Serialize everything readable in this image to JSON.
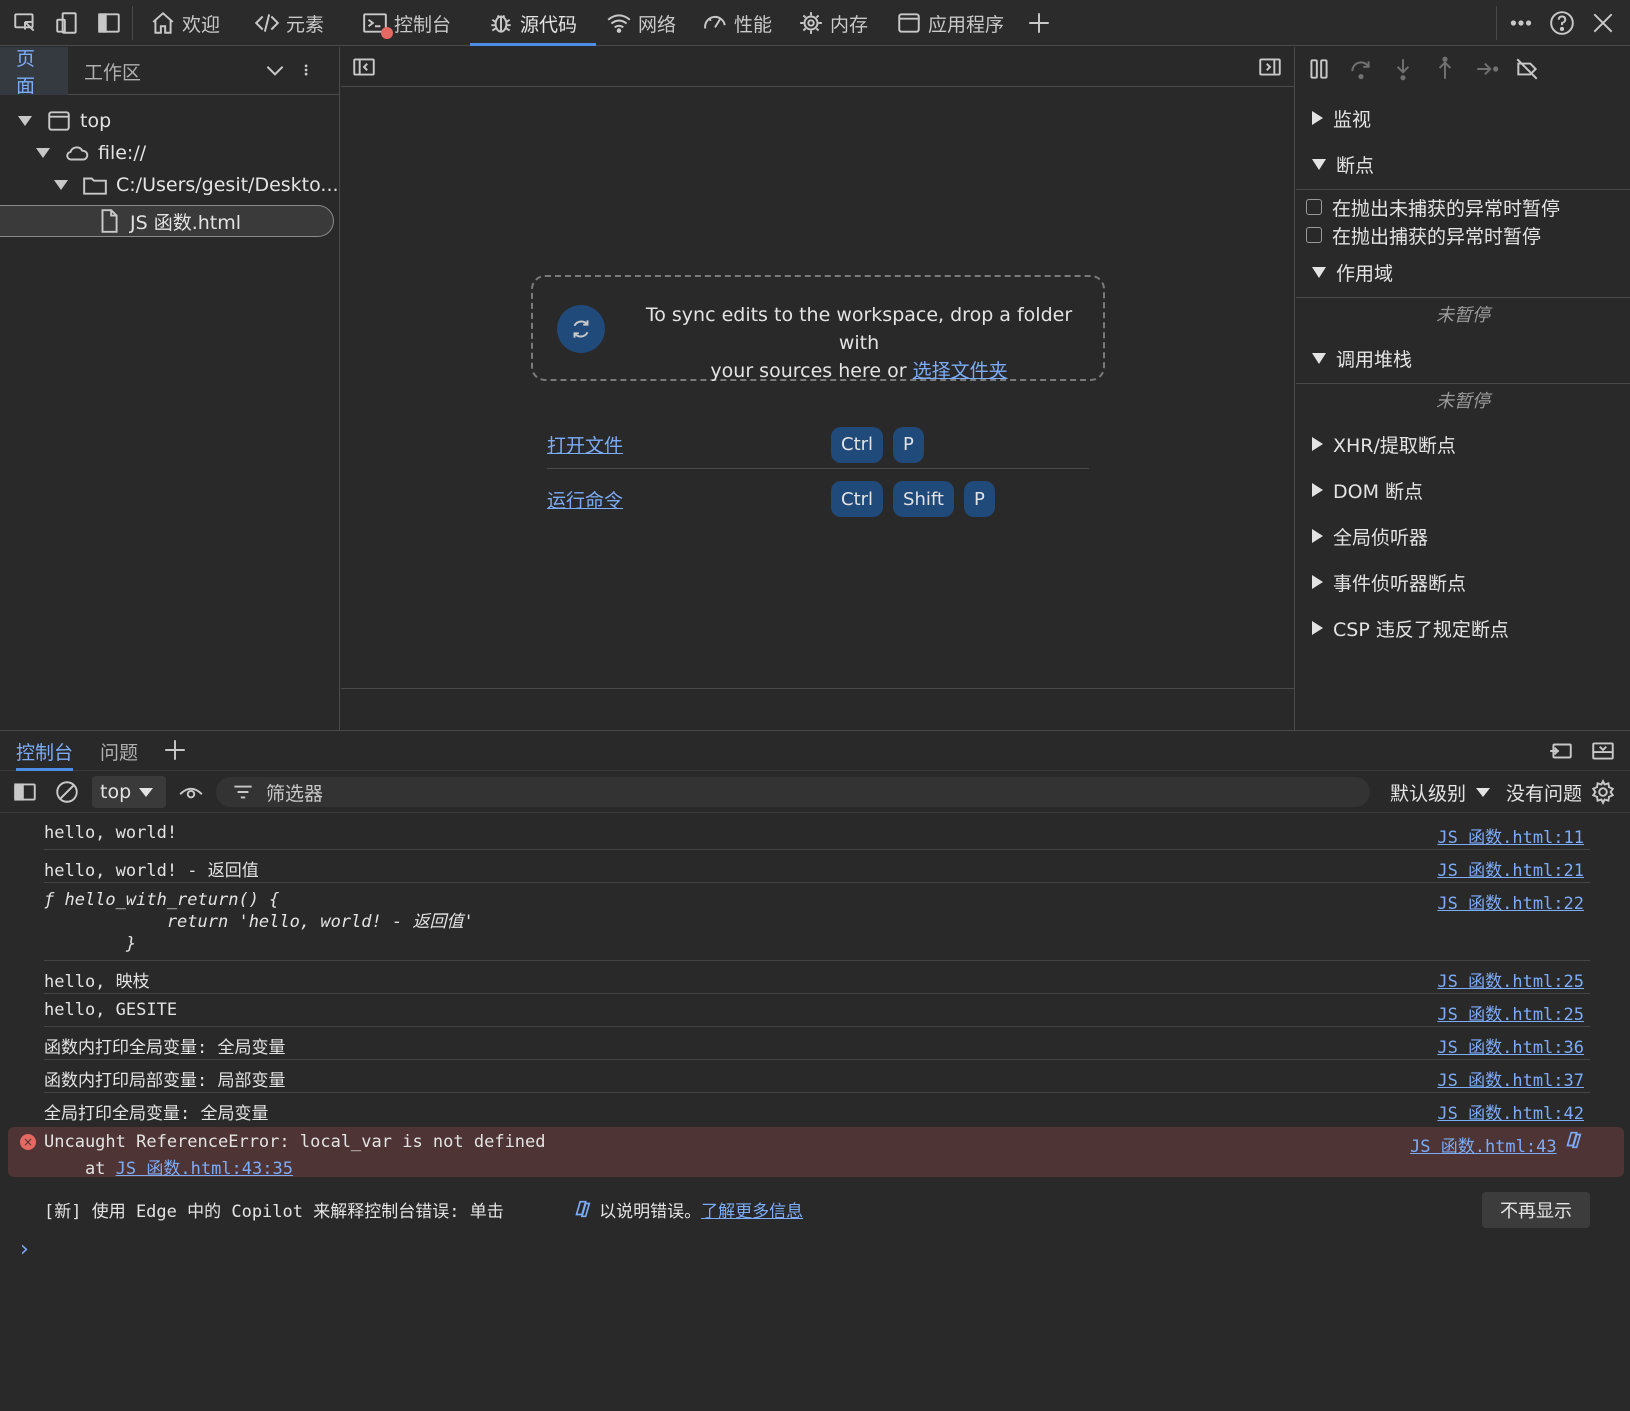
{
  "toolbar": {
    "tabs": [
      {
        "label": "欢迎",
        "icon": "home-icon"
      },
      {
        "label": "元素",
        "icon": "code-icon"
      },
      {
        "label": "控制台",
        "icon": "console-icon"
      },
      {
        "label": "源代码",
        "icon": "bug-icon"
      },
      {
        "label": "网络",
        "icon": "wifi-icon"
      },
      {
        "label": "性能",
        "icon": "speed-icon"
      },
      {
        "label": "内存",
        "icon": "chip-icon"
      },
      {
        "label": "应用程序",
        "icon": "app-window-icon"
      }
    ],
    "active_tab": "源代码"
  },
  "navigator": {
    "tabs": [
      "页面",
      "工作区"
    ],
    "tree": [
      {
        "label": "top",
        "icon": "frame-icon"
      },
      {
        "label": "file://",
        "icon": "cloud-icon"
      },
      {
        "label": "C:/Users/gesit/Deskto...",
        "icon": "folder-icon"
      },
      {
        "label": "JS 函数.html",
        "icon": "file-icon"
      }
    ]
  },
  "editor": {
    "dropzone_line1": "To sync edits to the workspace, drop a folder with",
    "dropzone_line2": "your sources here or ",
    "dropzone_link": "选择文件夹",
    "shortcuts": [
      {
        "label": "打开文件",
        "keys": [
          "Ctrl",
          "P"
        ]
      },
      {
        "label": "运行命令",
        "keys": [
          "Ctrl",
          "Shift",
          "P"
        ]
      }
    ]
  },
  "debugger": {
    "watch": "监视",
    "breakpoints": "断点",
    "pause_uncaught": "在抛出未捕获的异常时暂停",
    "pause_caught": "在抛出捕获的异常时暂停",
    "scope": "作用域",
    "scope_status": "未暂停",
    "callstack": "调用堆栈",
    "callstack_status": "未暂停",
    "sections": [
      "XHR/提取断点",
      "DOM 断点",
      "全局侦听器",
      "事件侦听器断点",
      "CSP 违反了规定断点"
    ]
  },
  "console": {
    "tabs": [
      "控制台",
      "问题"
    ],
    "context": "top",
    "filter_placeholder": "筛选器",
    "level": "默认级别",
    "issues": "没有问题",
    "messages": [
      {
        "text": "hello, world!",
        "src": "JS 函数.html:11"
      },
      {
        "text": "hello, world! - 返回值",
        "src": "JS 函数.html:21"
      },
      {
        "text": "ƒ hello_with_return() {\n            return 'hello, world! - 返回值'\n        }",
        "src": "JS 函数.html:22"
      },
      {
        "text": "hello, 映枝",
        "src": "JS 函数.html:25"
      },
      {
        "text": "hello, GESITE",
        "src": "JS 函数.html:25"
      },
      {
        "text": "函数内打印全局变量: 全局变量",
        "src": "JS 函数.html:36"
      },
      {
        "text": "函数内打印局部变量: 局部变量",
        "src": "JS 函数.html:37"
      },
      {
        "text": "全局打印全局变量: 全局变量",
        "src": "JS 函数.html:42"
      }
    ],
    "error": {
      "text": "Uncaught ReferenceError: local_var is not defined",
      "at_prefix": "    at ",
      "at_link": "JS 函数.html:43:35",
      "src": "JS 函数.html:43"
    },
    "copilot_text": "[新] 使用 Edge 中的 Copilot 来解释控制台错误: 单击",
    "copilot_text2": "以说明错误。",
    "copilot_link": "了解更多信息",
    "dismiss": "不再显示",
    "prompt": "›"
  }
}
